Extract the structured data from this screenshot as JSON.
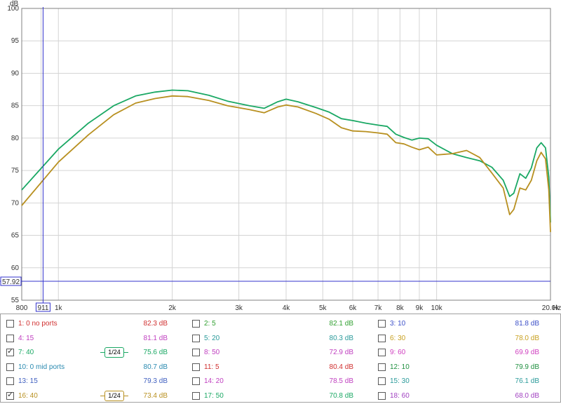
{
  "plot": {
    "y_unit": "dB",
    "x_unit": "Hz",
    "y_ticks": [
      "100",
      "95",
      "90",
      "85",
      "80",
      "75",
      "70",
      "65",
      "60",
      "55"
    ],
    "x_ticks": [
      "800",
      "1k",
      "2k",
      "3k",
      "4k",
      "5k",
      "6k",
      "7k",
      "8k",
      "9k",
      "10k",
      "20.0k"
    ],
    "cursor_x_label": "911",
    "cursor_y_label": "57.92",
    "colors": {
      "grid": "#d4d4d4",
      "cursor": "#3333cc",
      "frame": "#808080"
    }
  },
  "chart_data": {
    "type": "line",
    "xlabel": "Hz",
    "ylabel": "dB",
    "x_scale": "log",
    "xlim": [
      800,
      20000
    ],
    "ylim": [
      55,
      100
    ],
    "grid": true,
    "series": [
      {
        "name": "7: 40",
        "color": "#1aa864",
        "points": [
          [
            800,
            72.0
          ],
          [
            1000,
            78.3
          ],
          [
            1200,
            82.3
          ],
          [
            1400,
            85.0
          ],
          [
            1600,
            86.5
          ],
          [
            1800,
            87.1
          ],
          [
            2000,
            87.4
          ],
          [
            2200,
            87.3
          ],
          [
            2500,
            86.6
          ],
          [
            2800,
            85.7
          ],
          [
            3200,
            85.0
          ],
          [
            3500,
            84.6
          ],
          [
            3800,
            85.6
          ],
          [
            4000,
            86.0
          ],
          [
            4300,
            85.6
          ],
          [
            4800,
            84.7
          ],
          [
            5200,
            84.0
          ],
          [
            5600,
            83.0
          ],
          [
            6000,
            82.7
          ],
          [
            6500,
            82.3
          ],
          [
            7000,
            82.0
          ],
          [
            7400,
            81.8
          ],
          [
            7800,
            80.6
          ],
          [
            8200,
            80.1
          ],
          [
            8600,
            79.7
          ],
          [
            9000,
            80.0
          ],
          [
            9500,
            79.9
          ],
          [
            10000,
            78.9
          ],
          [
            11000,
            77.6
          ],
          [
            12000,
            77.0
          ],
          [
            13000,
            76.5
          ],
          [
            14000,
            75.5
          ],
          [
            15000,
            73.5
          ],
          [
            15600,
            71.0
          ],
          [
            16000,
            71.5
          ],
          [
            16600,
            74.5
          ],
          [
            17200,
            73.8
          ],
          [
            17800,
            75.4
          ],
          [
            18400,
            78.5
          ],
          [
            18900,
            79.3
          ],
          [
            19400,
            78.5
          ],
          [
            19800,
            74.0
          ],
          [
            20000,
            67.0
          ]
        ]
      },
      {
        "name": "16: 40",
        "color": "#b89020",
        "points": [
          [
            800,
            69.6
          ],
          [
            1000,
            76.3
          ],
          [
            1200,
            80.5
          ],
          [
            1400,
            83.6
          ],
          [
            1600,
            85.4
          ],
          [
            1800,
            86.1
          ],
          [
            2000,
            86.5
          ],
          [
            2200,
            86.4
          ],
          [
            2500,
            85.8
          ],
          [
            2800,
            85.0
          ],
          [
            3200,
            84.4
          ],
          [
            3500,
            83.9
          ],
          [
            3800,
            84.8
          ],
          [
            4000,
            85.1
          ],
          [
            4300,
            84.8
          ],
          [
            4800,
            83.8
          ],
          [
            5200,
            82.9
          ],
          [
            5600,
            81.6
          ],
          [
            6000,
            81.1
          ],
          [
            6500,
            81.0
          ],
          [
            7000,
            80.8
          ],
          [
            7400,
            80.6
          ],
          [
            7800,
            79.3
          ],
          [
            8200,
            79.1
          ],
          [
            8600,
            78.6
          ],
          [
            9000,
            78.2
          ],
          [
            9500,
            78.6
          ],
          [
            10000,
            77.4
          ],
          [
            11000,
            77.6
          ],
          [
            12000,
            78.1
          ],
          [
            13000,
            77.0
          ],
          [
            14000,
            74.6
          ],
          [
            15000,
            72.3
          ],
          [
            15600,
            68.2
          ],
          [
            16000,
            69.0
          ],
          [
            16600,
            72.3
          ],
          [
            17200,
            72.0
          ],
          [
            17800,
            73.5
          ],
          [
            18400,
            76.5
          ],
          [
            18900,
            77.8
          ],
          [
            19400,
            76.8
          ],
          [
            19800,
            72.0
          ],
          [
            20000,
            65.5
          ]
        ]
      }
    ]
  },
  "legend": {
    "rows": [
      [
        {
          "name": "1: 0 no ports",
          "color": "#d03030",
          "checked": false,
          "value": "82.3 dB",
          "valcolor": "#d03030"
        },
        {
          "name": "2: 5",
          "color": "#30a030",
          "checked": false,
          "value": "82.1 dB",
          "valcolor": "#30a030"
        },
        {
          "name": "3: 10",
          "color": "#3b4fc8",
          "checked": false,
          "value": "81.8 dB",
          "valcolor": "#3b4fc8"
        }
      ],
      [
        {
          "name": "4: 15",
          "color": "#c040c0",
          "checked": false,
          "value": "81.1 dB",
          "valcolor": "#c040c0"
        },
        {
          "name": "5: 20",
          "color": "#2a9a9a",
          "checked": false,
          "value": "80.3 dB",
          "valcolor": "#2a9a9a"
        },
        {
          "name": "6: 30",
          "color": "#c8a020",
          "checked": false,
          "value": "78.0 dB",
          "valcolor": "#c8a020"
        }
      ],
      [
        {
          "name": "7: 40",
          "color": "#1aa864",
          "checked": true,
          "value": "75.6 dB",
          "valcolor": "#1aa864",
          "smoothing": "1/24"
        },
        {
          "name": "8: 50",
          "color": "#c040c0",
          "checked": false,
          "value": "72.9 dB",
          "valcolor": "#c040c0"
        },
        {
          "name": "9: 60",
          "color": "#d040c0",
          "checked": false,
          "value": "69.9 dB",
          "valcolor": "#d040c0"
        }
      ],
      [
        {
          "name": "10: 0 mid ports",
          "color": "#2a8ab0",
          "checked": false,
          "value": "80.7 dB",
          "valcolor": "#2a8ab0"
        },
        {
          "name": "11: 5",
          "color": "#d03030",
          "checked": false,
          "value": "80.4 dB",
          "valcolor": "#d03030"
        },
        {
          "name": "12: 10",
          "color": "#209040",
          "checked": false,
          "value": "79.9 dB",
          "valcolor": "#209040"
        }
      ],
      [
        {
          "name": "13: 15",
          "color": "#4060c0",
          "checked": false,
          "value": "79.3 dB",
          "valcolor": "#4060c0"
        },
        {
          "name": "14: 20",
          "color": "#c040c0",
          "checked": false,
          "value": "78.5 dB",
          "valcolor": "#c040c0"
        },
        {
          "name": "15: 30",
          "color": "#2a9a9a",
          "checked": false,
          "value": "76.1 dB",
          "valcolor": "#2a9a9a"
        }
      ],
      [
        {
          "name": "16: 40",
          "color": "#b89020",
          "checked": true,
          "value": "73.4 dB",
          "valcolor": "#b89020",
          "smoothing": "1/24"
        },
        {
          "name": "17: 50",
          "color": "#1aa864",
          "checked": false,
          "value": "70.8 dB",
          "valcolor": "#1aa864"
        },
        {
          "name": "18: 60",
          "color": "#a040c0",
          "checked": false,
          "value": "68.0 dB",
          "valcolor": "#a040c0"
        }
      ]
    ]
  }
}
